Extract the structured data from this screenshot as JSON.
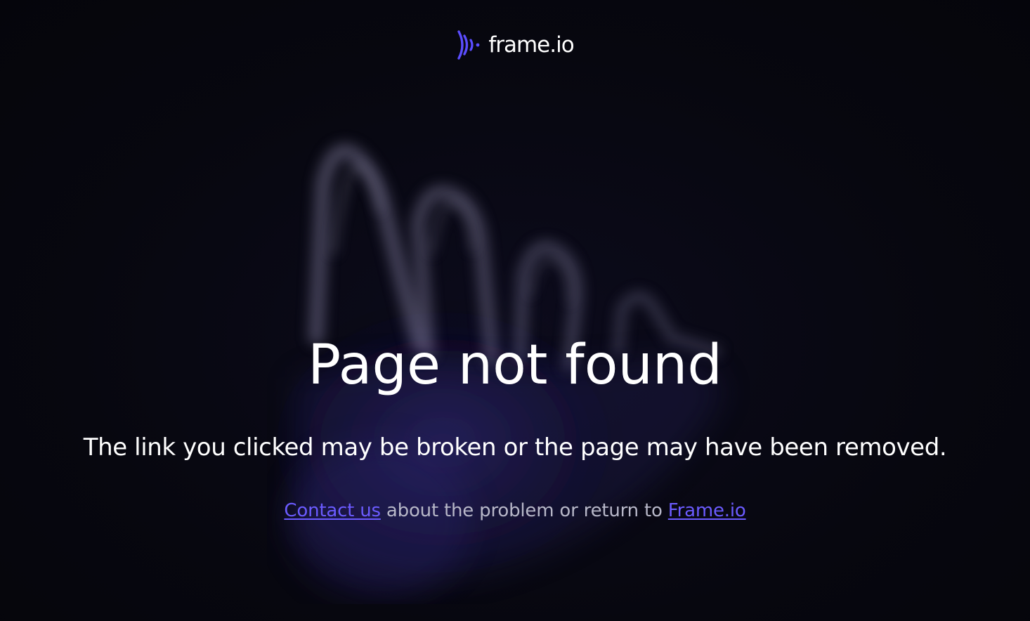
{
  "brand": {
    "name": "frame.io",
    "logo_icon": "frameio-logo-icon",
    "accent_color": "#5b4dff"
  },
  "main": {
    "title": "Page not found",
    "subtitle": "The link you clicked may be broken or the page may have been removed.",
    "help": {
      "contact_link": "Contact us",
      "middle_text": " about the problem or return to ",
      "home_link": "Frame.io"
    }
  },
  "colors": {
    "background": "#07070f",
    "link": "#6b5bff",
    "muted_text": "#b7b7c8",
    "text": "#ffffff"
  }
}
